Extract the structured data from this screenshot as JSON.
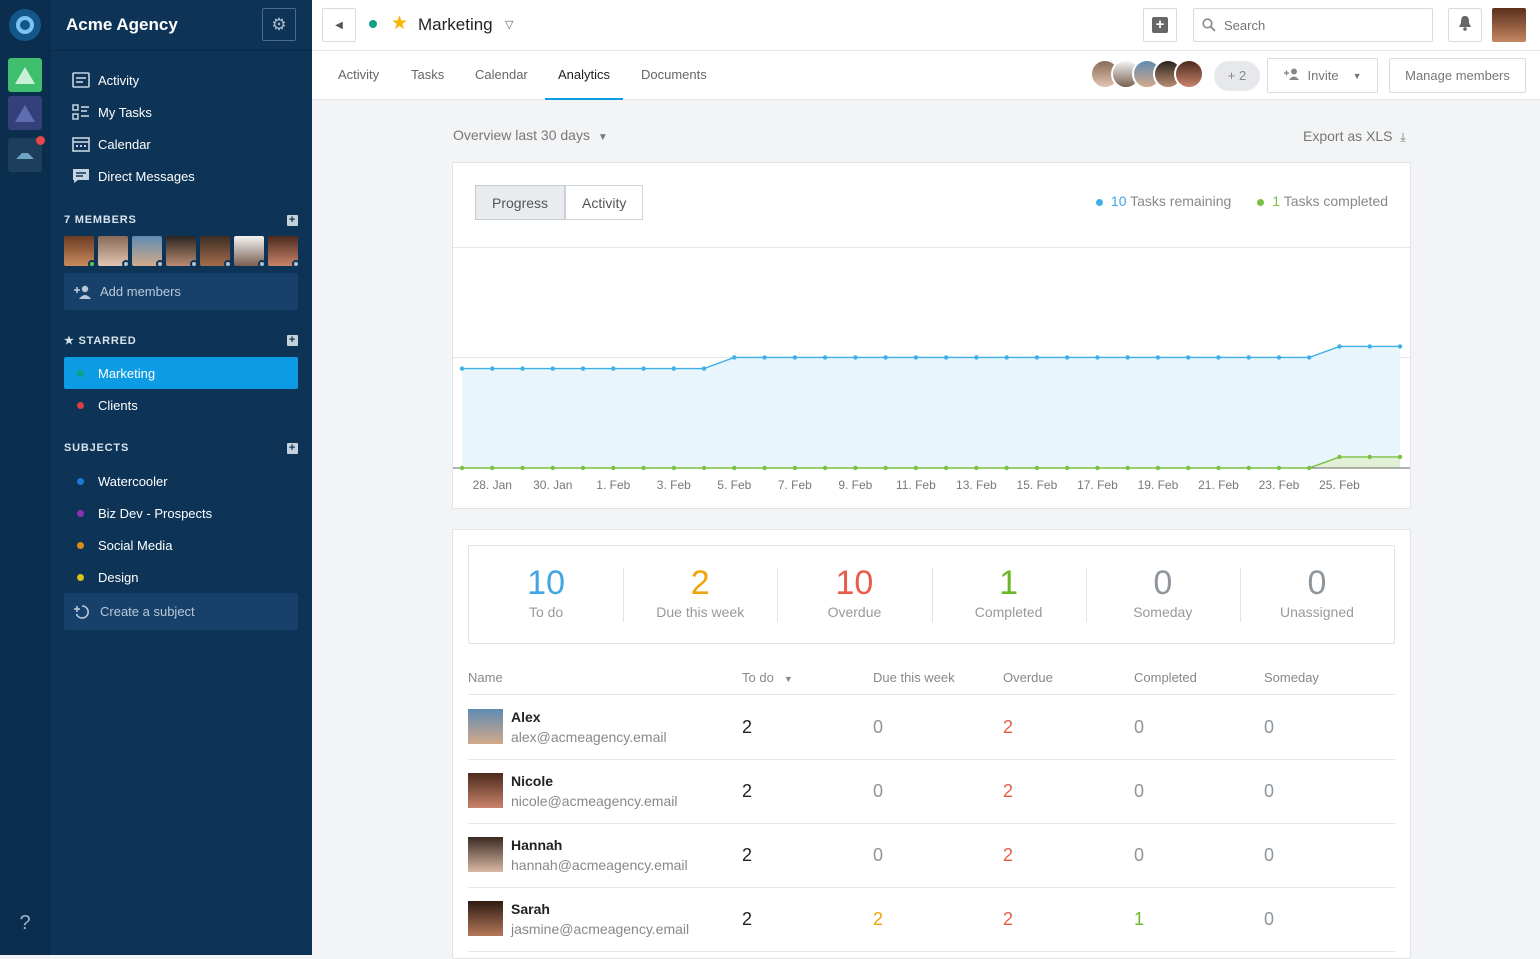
{
  "workspace": {
    "name": "Acme Agency"
  },
  "nav": [
    {
      "label": "Activity",
      "icon": "activity-icon"
    },
    {
      "label": "My Tasks",
      "icon": "tasks-icon"
    },
    {
      "label": "Calendar",
      "icon": "calendar-icon"
    },
    {
      "label": "Direct Messages",
      "icon": "message-icon"
    }
  ],
  "members_section": {
    "title": "7 MEMBERS",
    "add_label": "Add members"
  },
  "starred_section": {
    "title": "★ STARRED",
    "items": [
      {
        "label": "Marketing",
        "color": "#0fa08a",
        "active": true
      },
      {
        "label": "Clients",
        "color": "#d9403d",
        "active": false
      }
    ]
  },
  "subjects_section": {
    "title": "SUBJECTS",
    "items": [
      {
        "label": "Watercooler",
        "color": "#1d79d6"
      },
      {
        "label": "Biz Dev - Prospects",
        "color": "#8e2fb5"
      },
      {
        "label": "Social Media",
        "color": "#e0891b"
      },
      {
        "label": "Design",
        "color": "#d8c31a"
      }
    ],
    "create_label": "Create a subject"
  },
  "help": "?",
  "channel": {
    "title": "Marketing"
  },
  "search": {
    "placeholder": "Search"
  },
  "tabs": [
    "Activity",
    "Tasks",
    "Calendar",
    "Analytics",
    "Documents"
  ],
  "active_tab": "Analytics",
  "extra_members": "+ 2",
  "invite_label": "Invite",
  "manage_label": "Manage members",
  "overview_label": "Overview last 30 days",
  "export_label": "Export as XLS",
  "chart_toggle": [
    "Progress",
    "Activity"
  ],
  "legend": {
    "remaining_count": "10",
    "remaining_label": "Tasks remaining",
    "completed_count": "1",
    "completed_label": "Tasks completed"
  },
  "colors": {
    "remaining": "#3fb0e6",
    "completed": "#7ac143",
    "overdue": "#e85c49",
    "due": "#f0a30a",
    "todo": "#3fa5e3"
  },
  "chart_data": {
    "type": "area",
    "x_ticks": [
      "28. Jan",
      "30. Jan",
      "1. Feb",
      "3. Feb",
      "5. Feb",
      "7. Feb",
      "9. Feb",
      "11. Feb",
      "13. Feb",
      "15. Feb",
      "17. Feb",
      "19. Feb",
      "21. Feb",
      "23. Feb",
      "25. Feb"
    ],
    "series": [
      {
        "name": "Tasks remaining",
        "values": [
          9,
          9,
          9,
          9,
          9,
          9,
          9,
          9,
          9,
          10,
          10,
          10,
          10,
          10,
          10,
          10,
          10,
          10,
          10,
          10,
          10,
          10,
          10,
          10,
          10,
          10,
          10,
          10,
          10,
          11,
          11,
          11
        ]
      },
      {
        "name": "Tasks completed",
        "values": [
          0,
          0,
          0,
          0,
          0,
          0,
          0,
          0,
          0,
          0,
          0,
          0,
          0,
          0,
          0,
          0,
          0,
          0,
          0,
          0,
          0,
          0,
          0,
          0,
          0,
          0,
          0,
          0,
          0,
          1,
          1,
          1
        ]
      }
    ],
    "ylim": [
      0,
      19
    ]
  },
  "stats": [
    {
      "value": "10",
      "label": "To do",
      "color": "#3fa5e3"
    },
    {
      "value": "2",
      "label": "Due this week",
      "color": "#f0a30a"
    },
    {
      "value": "10",
      "label": "Overdue",
      "color": "#e85c49"
    },
    {
      "value": "1",
      "label": "Completed",
      "color": "#6ab825"
    },
    {
      "value": "0",
      "label": "Someday",
      "color": "#8e959c"
    },
    {
      "value": "0",
      "label": "Unassigned",
      "color": "#8e959c"
    }
  ],
  "table": {
    "headers": [
      "Name",
      "To do",
      "Due this week",
      "Overdue",
      "Completed",
      "Someday"
    ],
    "rows": [
      {
        "name": "Alex",
        "email": "alex@acmeagency.email",
        "todo": "2",
        "due": "0",
        "overdue": "2",
        "completed": "0",
        "someday": "0"
      },
      {
        "name": "Nicole",
        "email": "nicole@acmeagency.email",
        "todo": "2",
        "due": "0",
        "overdue": "2",
        "completed": "0",
        "someday": "0"
      },
      {
        "name": "Hannah",
        "email": "hannah@acmeagency.email",
        "todo": "2",
        "due": "0",
        "overdue": "2",
        "completed": "0",
        "someday": "0"
      },
      {
        "name": "Sarah",
        "email": "jasmine@acmeagency.email",
        "todo": "2",
        "due": "2",
        "overdue": "2",
        "completed": "1",
        "someday": "0"
      }
    ]
  }
}
